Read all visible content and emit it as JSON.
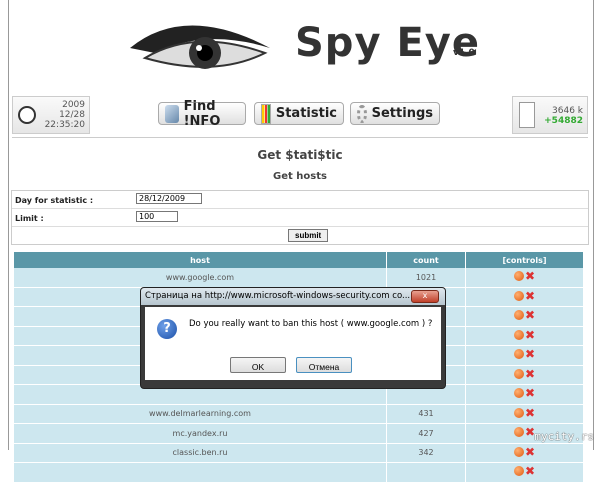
{
  "logo": {
    "title": "Spy Eye",
    "version": "v1.0"
  },
  "clock": {
    "year": "2009",
    "date": "12/28",
    "time": "22:35:20"
  },
  "nav": [
    {
      "label": "Find !NFO"
    },
    {
      "label": "Statistic"
    },
    {
      "label": "Settings"
    }
  ],
  "stats": {
    "size": "3646 k",
    "delta": "+54882"
  },
  "page": {
    "title": "Get $tati$tic",
    "subtitle": "Get hosts"
  },
  "form": {
    "day_label": "Day for statistic :",
    "day_value": "28/12/2009",
    "limit_label": "Limit :",
    "limit_value": "100",
    "submit": "submit"
  },
  "table": {
    "headers": [
      "host",
      "count",
      "[controls]"
    ],
    "rows": [
      {
        "host": "www.google.com",
        "count": "1021"
      },
      {
        "host": "",
        "count": ""
      },
      {
        "host": "",
        "count": ""
      },
      {
        "host": "",
        "count": ""
      },
      {
        "host": "",
        "count": ""
      },
      {
        "host": "",
        "count": ""
      },
      {
        "host": "",
        "count": ""
      },
      {
        "host": "www.delmarlearning.com",
        "count": "431"
      },
      {
        "host": "mc.yandex.ru",
        "count": "427"
      },
      {
        "host": "classic.ben.ru",
        "count": "342"
      },
      {
        "host": "",
        "count": ""
      }
    ]
  },
  "dialog": {
    "title": "Страница на http://www.microsoft-windows-security.com co...",
    "message": "Do you really want to ban this host ( www.google.com ) ?",
    "ok": "OK",
    "cancel": "Отмена"
  },
  "watermark": "mycity.rs"
}
